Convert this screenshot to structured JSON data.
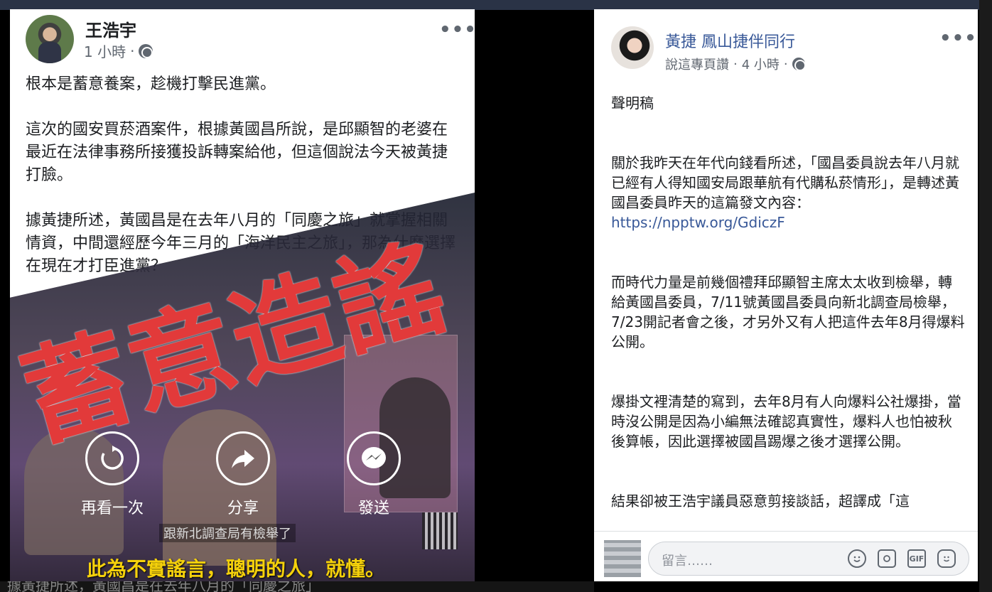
{
  "left_post": {
    "author": "王浩宇",
    "time": "1 小時",
    "separator": "·",
    "paragraphs": [
      "根本是蓄意養案，趁機打擊民進黨。",
      "這次的國安買菸酒案件，根據黃國昌所說，是邱顯智的老婆在最近在法律事務所接獲投訴轉案給他，但這個說法今天被黃捷打臉。",
      "據黃捷所述，黃國昌是在去年八月的「同慶之旅」就掌握相關情資，中間還經歷今年三月的「海洋民主之旅」，那為什麼選擇在現在才打臣進黨？"
    ],
    "video": {
      "overlay_slogan": "蓄意造謠",
      "controls": {
        "replay": "再看一次",
        "share": "分享",
        "send": "發送"
      },
      "news_caption": "跟新北調查局有檢舉了",
      "subtitle": "此為不實謠言，聰明的人，就懂。"
    }
  },
  "right_post": {
    "author": "黃捷 鳳山捷伴同行",
    "meta_action": "說這專頁讚",
    "time": "4 小時",
    "separator": "·",
    "paragraphs": [
      "聲明稿",
      "關於我昨天在年代向錢看所述，「國昌委員說去年八月就已經有人得知國安局跟華航有代購私菸情形」，是轉述黃國昌委員昨天的這篇發文內容：",
      "而時代力量是前幾個禮拜邱顯智主席太太收到檢舉，轉給黃國昌委員，7/11號黃國昌委員向新北調查局檢舉，7/23開記者會之後，才另外又有人把這件去年8月得爆料公開。",
      "爆掛文裡清楚的寫到，去年8月有人向爆料公社爆掛，當時沒公開是因為小編無法確認真實性，爆料人也怕被秋後算帳，因此選擇被國昌踢爆之後才選擇公開。",
      "結果卻被王浩宇議員惡意剪接談話，超譯成「這"
    ],
    "link": "https://npptw.org/GdiczF",
    "comment_placeholder": "留言……"
  },
  "background_strip_text": "據黃捷所述，黃國昌是在去年八月的「同慶之旅」",
  "colors": {
    "slogan_red": "#e23a3a",
    "subtitle_yellow": "#f5d10b",
    "link_blue": "#385898"
  },
  "icons": [
    "globe-icon",
    "more-icon",
    "replay-icon",
    "share-icon",
    "messenger-icon",
    "emoji-icon",
    "camera-icon",
    "gif-icon",
    "sticker-icon"
  ]
}
